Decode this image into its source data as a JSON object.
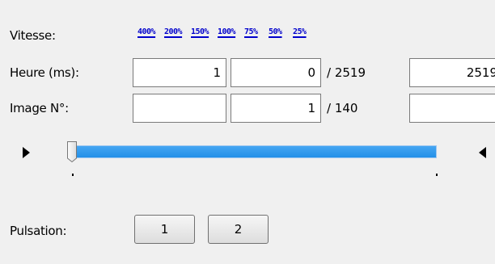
{
  "speed": {
    "label": "Vitesse:",
    "options": [
      "400%",
      "200%",
      "150%",
      "100%",
      "75%",
      "50%",
      "25%"
    ]
  },
  "time": {
    "label": "Heure (ms):",
    "value_a": "1",
    "value_b": "0",
    "total": "/ 2519",
    "value_c": "2519"
  },
  "image": {
    "label": "Image N°:",
    "value_a": "",
    "value_b": "1",
    "total": "/ 140",
    "value_c": ""
  },
  "slider": {
    "position_fraction": 0.0,
    "track_color": "#2f9bf0"
  },
  "pulsation": {
    "label": "Pulsation:",
    "buttons": [
      "1",
      "2"
    ]
  }
}
